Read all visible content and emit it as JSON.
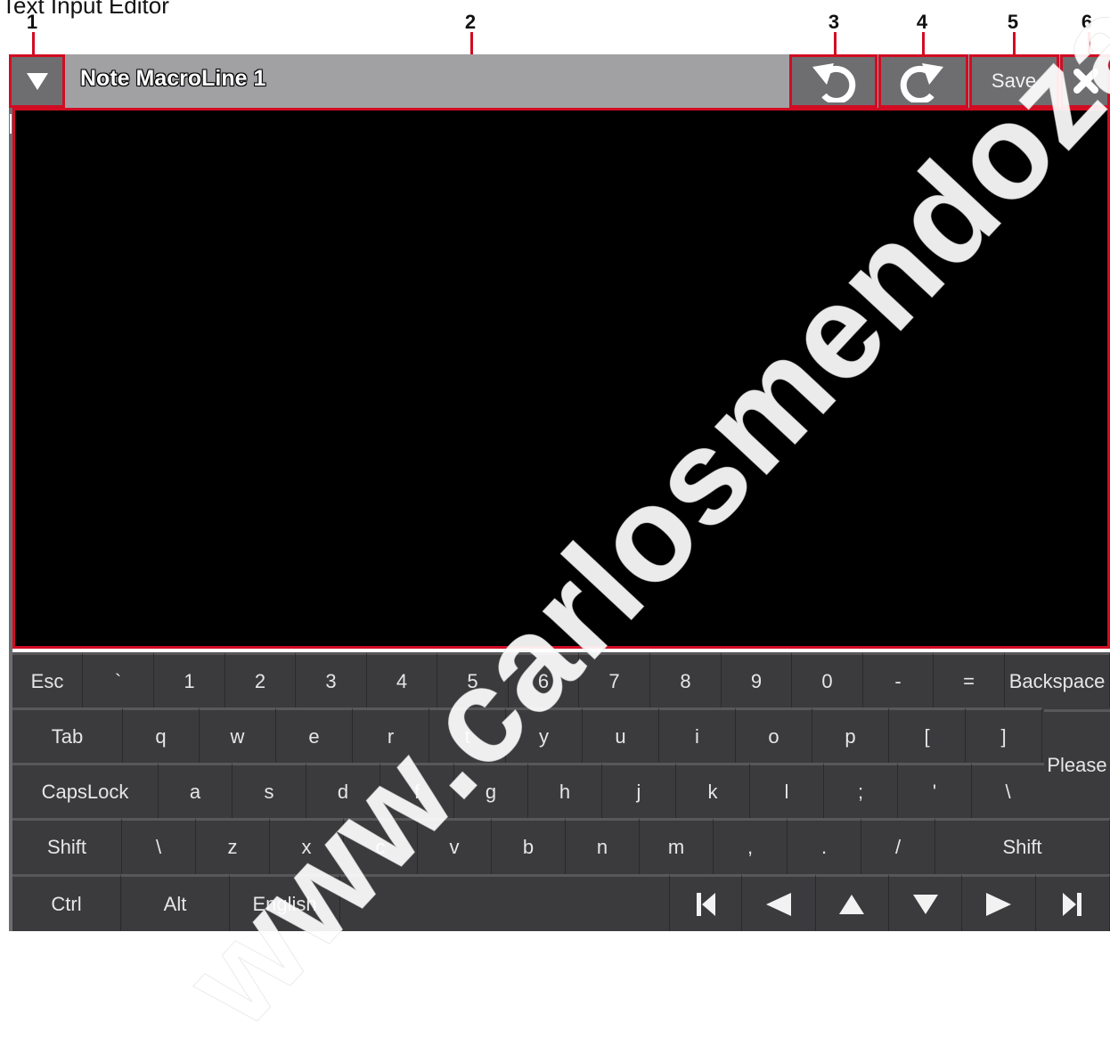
{
  "document_title": "Text Input Editor",
  "callouts": [
    "1",
    "2",
    "3",
    "4",
    "5",
    "6"
  ],
  "window": {
    "title": "Note MacroLine 1",
    "menu_icon": "triangle-down-icon",
    "undo_icon": "undo-icon",
    "redo_icon": "redo-icon",
    "save_label": "Save",
    "close_icon": "close-icon"
  },
  "editor": {
    "value": ""
  },
  "keyboard": {
    "row1": [
      "Esc",
      "`",
      "1",
      "2",
      "3",
      "4",
      "5",
      "6",
      "7",
      "8",
      "9",
      "0",
      "-",
      "=",
      "Backspace"
    ],
    "row2": [
      "Tab",
      "q",
      "w",
      "e",
      "r",
      "t",
      "y",
      "u",
      "i",
      "o",
      "p",
      "[",
      "]"
    ],
    "row3": [
      "CapsLock",
      "a",
      "s",
      "d",
      "f",
      "g",
      "h",
      "j",
      "k",
      "l",
      ";",
      "'",
      "\\"
    ],
    "row4": [
      "Shift",
      "\\",
      "z",
      "x",
      "c",
      "v",
      "b",
      "n",
      "m",
      ",",
      ".",
      "/",
      "Shift"
    ],
    "row5": [
      "Ctrl",
      "Alt",
      "English",
      ""
    ],
    "please_label": "Please",
    "nav_icons": [
      "skip-to-start-icon",
      "arrow-left-icon",
      "arrow-up-icon",
      "arrow-down-icon",
      "arrow-right-icon",
      "skip-to-end-icon"
    ]
  },
  "watermark": "www.carlosmendoza.",
  "colors": {
    "highlight": "#d10c22",
    "titlebar": "#a1a1a4",
    "button": "#6e6e71",
    "key": "#3b3b3e",
    "editor": "#000000"
  }
}
